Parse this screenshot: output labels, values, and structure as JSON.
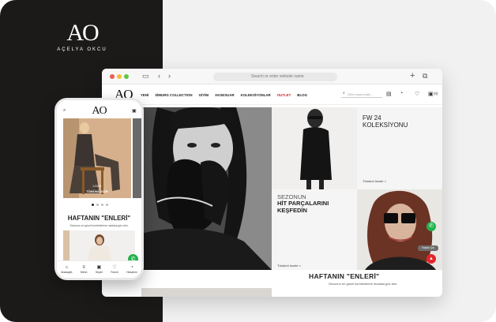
{
  "brand": {
    "monogram": "AO",
    "name": "AÇELYA OKCU"
  },
  "browser": {
    "address_placeholder": "Search or enter website name",
    "dots": [
      "#ee5b52",
      "#f4bd39",
      "#5fc640"
    ]
  },
  "site": {
    "logo": "AO",
    "menu": [
      {
        "label": "YENİ"
      },
      {
        "label": "SİMURG COLLECTION"
      },
      {
        "label": "GİYİM"
      },
      {
        "label": "AKSESUAR"
      },
      {
        "label": "KOLEKSİYONLAR"
      },
      {
        "label": "OUTLET"
      },
      {
        "label": "BLOG"
      }
    ],
    "search_placeholder": "Ürün veya kolek...",
    "cart_count": "(0)",
    "tile_fw": {
      "line1": "FW 24",
      "line2": "KOLEKSİYONU",
      "link": "Tümünü İncele >"
    },
    "tile_season": {
      "line1": "SEZONUN",
      "line2": "HİT PARÇALARINI",
      "line3": "KEŞFEDİN",
      "link": "Tümünü İncele >"
    },
    "best_title": "HAFTANIN \"ENLERİ\"",
    "best_sub": "Sezonun en güzel kombinlerine mutlaka göz atın.",
    "tooltip": "Yukarı Çık",
    "accent_outlet": "#d62020",
    "whatsapp_color": "#21b24b"
  },
  "phone": {
    "logo": "AO",
    "banner_caption": "LOOK",
    "banner_button": "TÜMÜNÜ GÖR",
    "head": "HAFTANIN \"ENLERİ\"",
    "sub": "Sezonun en güzel kombinlerine mutlaka göz atın.",
    "tabs": [
      {
        "label": "Anasayfa",
        "icon": "home-icon"
      },
      {
        "label": "Menü",
        "icon": "menu-icon"
      },
      {
        "label": "Sepet",
        "icon": "bag-icon"
      },
      {
        "label": "Favori",
        "icon": "heart-icon"
      },
      {
        "label": "Hesabım",
        "icon": "user-icon"
      }
    ]
  }
}
